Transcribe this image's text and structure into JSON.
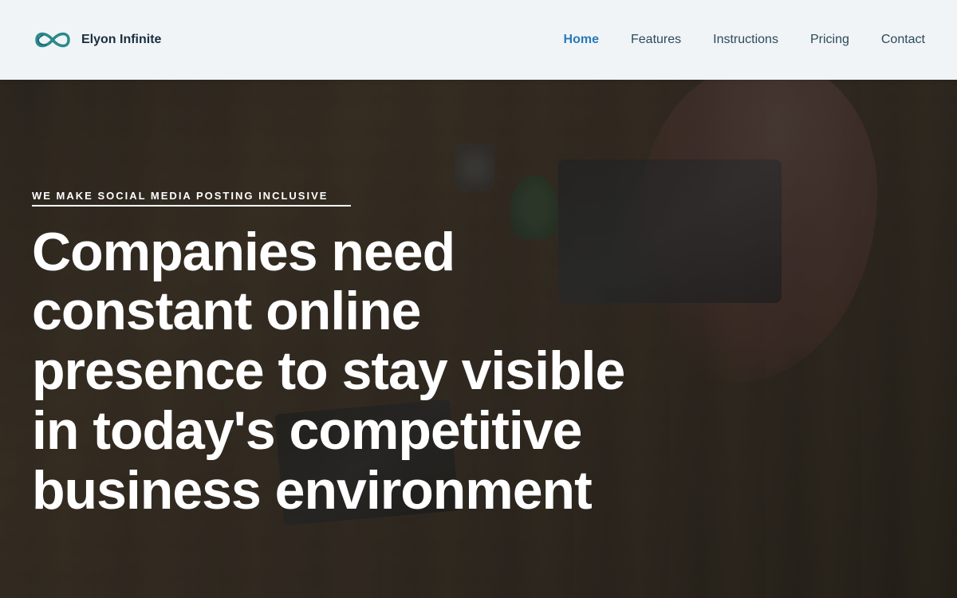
{
  "brand": {
    "name": "Elyon Infinite",
    "logo_alt": "Elyon Infinite Logo"
  },
  "nav": {
    "links": [
      {
        "id": "home",
        "label": "Home",
        "active": true
      },
      {
        "id": "features",
        "label": "Features",
        "active": false
      },
      {
        "id": "instructions",
        "label": "Instructions",
        "active": false
      },
      {
        "id": "pricing",
        "label": "Pricing",
        "active": false
      },
      {
        "id": "contact",
        "label": "Contact",
        "active": false
      }
    ]
  },
  "hero": {
    "tagline": "WE MAKE SOCIAL MEDIA POSTING INCLUSIVE",
    "headline": "Companies need constant online presence to stay visible in today's competitive business environment"
  },
  "colors": {
    "nav_active": "#2a7ab8",
    "nav_text": "#2c4a5a",
    "hero_text": "#ffffff",
    "overlay": "rgba(10,20,30,0.55)"
  }
}
